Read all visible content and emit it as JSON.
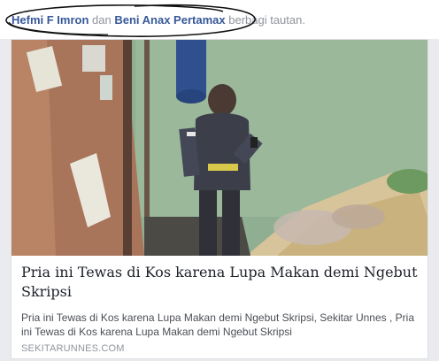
{
  "story": {
    "actor1": "Hefmi F Imron",
    "connector": "dan",
    "actor2": "Beni Anax Pertamax",
    "action": "berbagi tautan."
  },
  "link": {
    "image_description_icon": "photo-thumbnail",
    "title": "Pria ini Tewas di Kos karena Lupa Makan demi Ngebut Skripsi",
    "description": "Pria ini Tewas di Kos karena Lupa Makan demi Ngebut Skripsi, Sekitar Unnes , Pria ini Tewas di Kos karena Lupa Makan demi Ngebut Skripsi",
    "domain": "SEKITARUNNES.COM"
  },
  "colors": {
    "actor_link": "#365899",
    "secondary_text": "#90949c",
    "title_text": "#1d2129"
  }
}
